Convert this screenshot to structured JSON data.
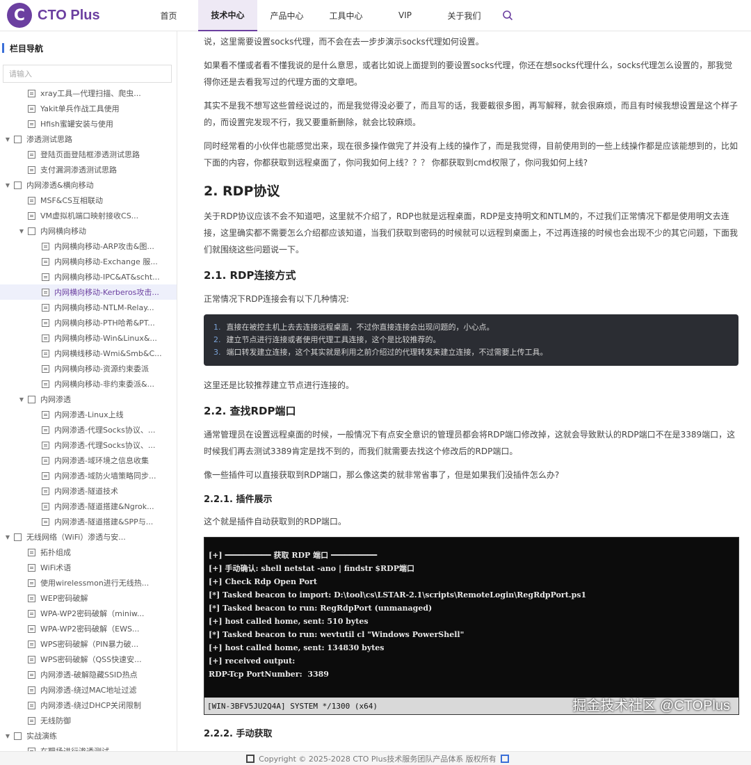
{
  "header": {
    "logo_mark": "C",
    "logo_text": "CTO Plus",
    "nav": [
      "首页",
      "技术中心",
      "产品中心",
      "工具中心",
      "VIP",
      "关于我们"
    ],
    "active_nav": 1
  },
  "sidebar": {
    "title": "栏目导航",
    "search_placeholder": "请输入",
    "items": [
      {
        "label": "xray工具—代理扫描、爬虫...",
        "level": 2
      },
      {
        "label": "Yakit单兵作战工具使用",
        "level": 2
      },
      {
        "label": "Hfish蜜罐安装与使用",
        "level": 2
      },
      {
        "label": "渗透测试思路",
        "level": 1,
        "folder": true
      },
      {
        "label": "登陆页面登陆框渗透测试思路",
        "level": 2
      },
      {
        "label": "支付漏洞渗透测试思路",
        "level": 2
      },
      {
        "label": "内网渗透&横向移动",
        "level": 1,
        "folder": true
      },
      {
        "label": "MSF&CS互相联动",
        "level": 2
      },
      {
        "label": "VM虚拟机端口映射接收CS...",
        "level": 2
      },
      {
        "label": "内网横向移动",
        "level": 2,
        "folder": true
      },
      {
        "label": "内网横向移动-ARP攻击&图...",
        "level": 3
      },
      {
        "label": "内网横向移动-Exchange 服...",
        "level": 3
      },
      {
        "label": "内网横向移动-IPC&AT&scht...",
        "level": 3
      },
      {
        "label": "内网横向移动-Kerberos攻击...",
        "level": 3,
        "active": true
      },
      {
        "label": "内网横向移动-NTLM-Relay...",
        "level": 3
      },
      {
        "label": "内网横向移动-PTH哈希&PT...",
        "level": 3
      },
      {
        "label": "内网横向移动-Win&Linux&...",
        "level": 3
      },
      {
        "label": "内网横线移动-Wmi&Smb&C...",
        "level": 3
      },
      {
        "label": "内网横向移动-资源约束委派",
        "level": 3
      },
      {
        "label": "内网横向移动-非约束委派&...",
        "level": 3
      },
      {
        "label": "内网渗透",
        "level": 2,
        "folder": true
      },
      {
        "label": "内网渗透-Linux上线",
        "level": 3
      },
      {
        "label": "内网渗透-代理Socks协议、...",
        "level": 3
      },
      {
        "label": "内网渗透-代理Socks协议、...",
        "level": 3
      },
      {
        "label": "内网渗透-域环境之信息收集",
        "level": 3
      },
      {
        "label": "内网渗透-域防火墙策略同步...",
        "level": 3
      },
      {
        "label": "内网渗透-隧道技术",
        "level": 3
      },
      {
        "label": "内网渗透-隧道搭建&Ngrok...",
        "level": 3
      },
      {
        "label": "内网渗透-隧道搭建&SPP与...",
        "level": 3
      },
      {
        "label": "无线网络（WiFi）渗透与安...",
        "level": 1,
        "folder": true
      },
      {
        "label": "拓扑组成",
        "level": 2
      },
      {
        "label": "WiFi术语",
        "level": 2
      },
      {
        "label": "使用wirelessmon进行无线热...",
        "level": 2
      },
      {
        "label": "WEP密码破解",
        "level": 2
      },
      {
        "label": "WPA-WP2密码破解（miniw...",
        "level": 2
      },
      {
        "label": "WPA-WP2密码破解（EWS...",
        "level": 2
      },
      {
        "label": "WPS密码破解（PIN暴力破...",
        "level": 2
      },
      {
        "label": "WPS密码破解（QSS快速安...",
        "level": 2
      },
      {
        "label": "内网渗透-破解隐藏SSID热点",
        "level": 2
      },
      {
        "label": "内网渗透-绕过MAC地址过滤",
        "level": 2
      },
      {
        "label": "内网渗透-绕过DHCP关闭限制",
        "level": 2
      },
      {
        "label": "无线防御",
        "level": 2
      },
      {
        "label": "实战演练",
        "level": 1,
        "folder": true
      },
      {
        "label": "在靶场进行渗透测试",
        "level": 2
      }
    ]
  },
  "article": {
    "p1": "说，这里需要设置socks代理，而不会在去一步步演示socks代理如何设置。",
    "p2": "如果看不懂或者看不懂我说的是什么意思，或者比如说上面提到的要设置socks代理，你还在想socks代理什么，socks代理怎么设置的，那我觉得你还是去看我写过的代理方面的文章吧。",
    "p3": "其实不是我不想写这些曾经说过的，而是我觉得没必要了，而且写的话，我要截很多图，再写解释，就会很麻烦，而且有时候我想设置是这个样子的，而设置完发现不行，我又要重新删除，就会比较麻烦。",
    "p4": "同时经常看的小伙伴也能感觉出来，现在很多操作做完了并没有上线的操作了，而是我觉得，目前使用到的一些上线操作都是应该能想到的，比如下面的内容，你都获取到远程桌面了，你问我如何上线？？？ 你都获取到cmd权限了，你问我如何上线?",
    "h2": "2. RDP协议",
    "p5": "关于RDP协议应该不会不知道吧，这里就不介绍了，RDP也就是远程桌面，RDP是支持明文和NTLM的，不过我们正常情况下都是使用明文去连接，这里确实都不需要怎么介绍都应该知道，当我们获取到密码的时候就可以远程到桌面上，不过再连接的时候也会出现不少的其它问题，下面我们就围绕这些问题说一下。",
    "h3a": "2.1. RDP连接方式",
    "p6": "正常情况下RDP连接会有以下几种情况:",
    "list": [
      "直接在被控主机上去去连接远程桌面，不过你直接连接会出现问题的，小心点。",
      "建立节点进行连接或者使用代理工具连接，这个是比较推荐的。",
      "端口转发建立连接，这个其实就是利用之前介绍过的代理转发来建立连接，不过需要上传工具。"
    ],
    "p7": "这里还是比较推荐建立节点进行连接的。",
    "h3b": "2.2. 查找RDP端口",
    "p8": "通常管理员在设置远程桌面的时候，一般情况下有点安全意识的管理员都会将RDP端口修改掉，这就会导致默认的RDP端口不在是3389端口，这时候我们再去测试3389肯定是找不到的，而我们就需要去找这个修改后的RDP端口。",
    "p9": "像一些插件可以直接获取到RDP端口，那么像这类的就非常省事了，但是如果我们没插件怎么办?",
    "h4a": "2.2.1. 插件展示",
    "p10": "这个就是插件自动获取到的RDP端口。",
    "terminal": [
      "[+] ━━━━━━━━━━ 获取 RDP 端口 ━━━━━━━━━━",
      "[+] 手动确认: shell netstat -ano | findstr $RDP端口",
      "[+] Check Rdp Open Port",
      "[*] Tasked beacon to import: D:\\tool\\cs\\LSTAR-2.1\\scripts\\RemoteLogin\\RegRdpPort.ps1",
      "[*] Tasked beacon to run: RegRdpPort (unmanaged)",
      "[+] host called home, sent: 510 bytes",
      "[*] Tasked beacon to run: wevtutil cl \"Windows PowerShell\"",
      "[+] host called home, sent: 134830 bytes",
      "[+] received output:",
      "RDP-Tcp PortNumber:  3389"
    ],
    "terminal_status": "[WIN-3BFV5JU2Q4A] SYSTEM */1300  (x64)",
    "h4b": "2.2.2. 手动获取"
  },
  "overlay_tag": "掘金技术社区 @CTOPlus",
  "footer": "Copyright © 2025-2028 CTO Plus技术服务团队产品体系 版权所有"
}
